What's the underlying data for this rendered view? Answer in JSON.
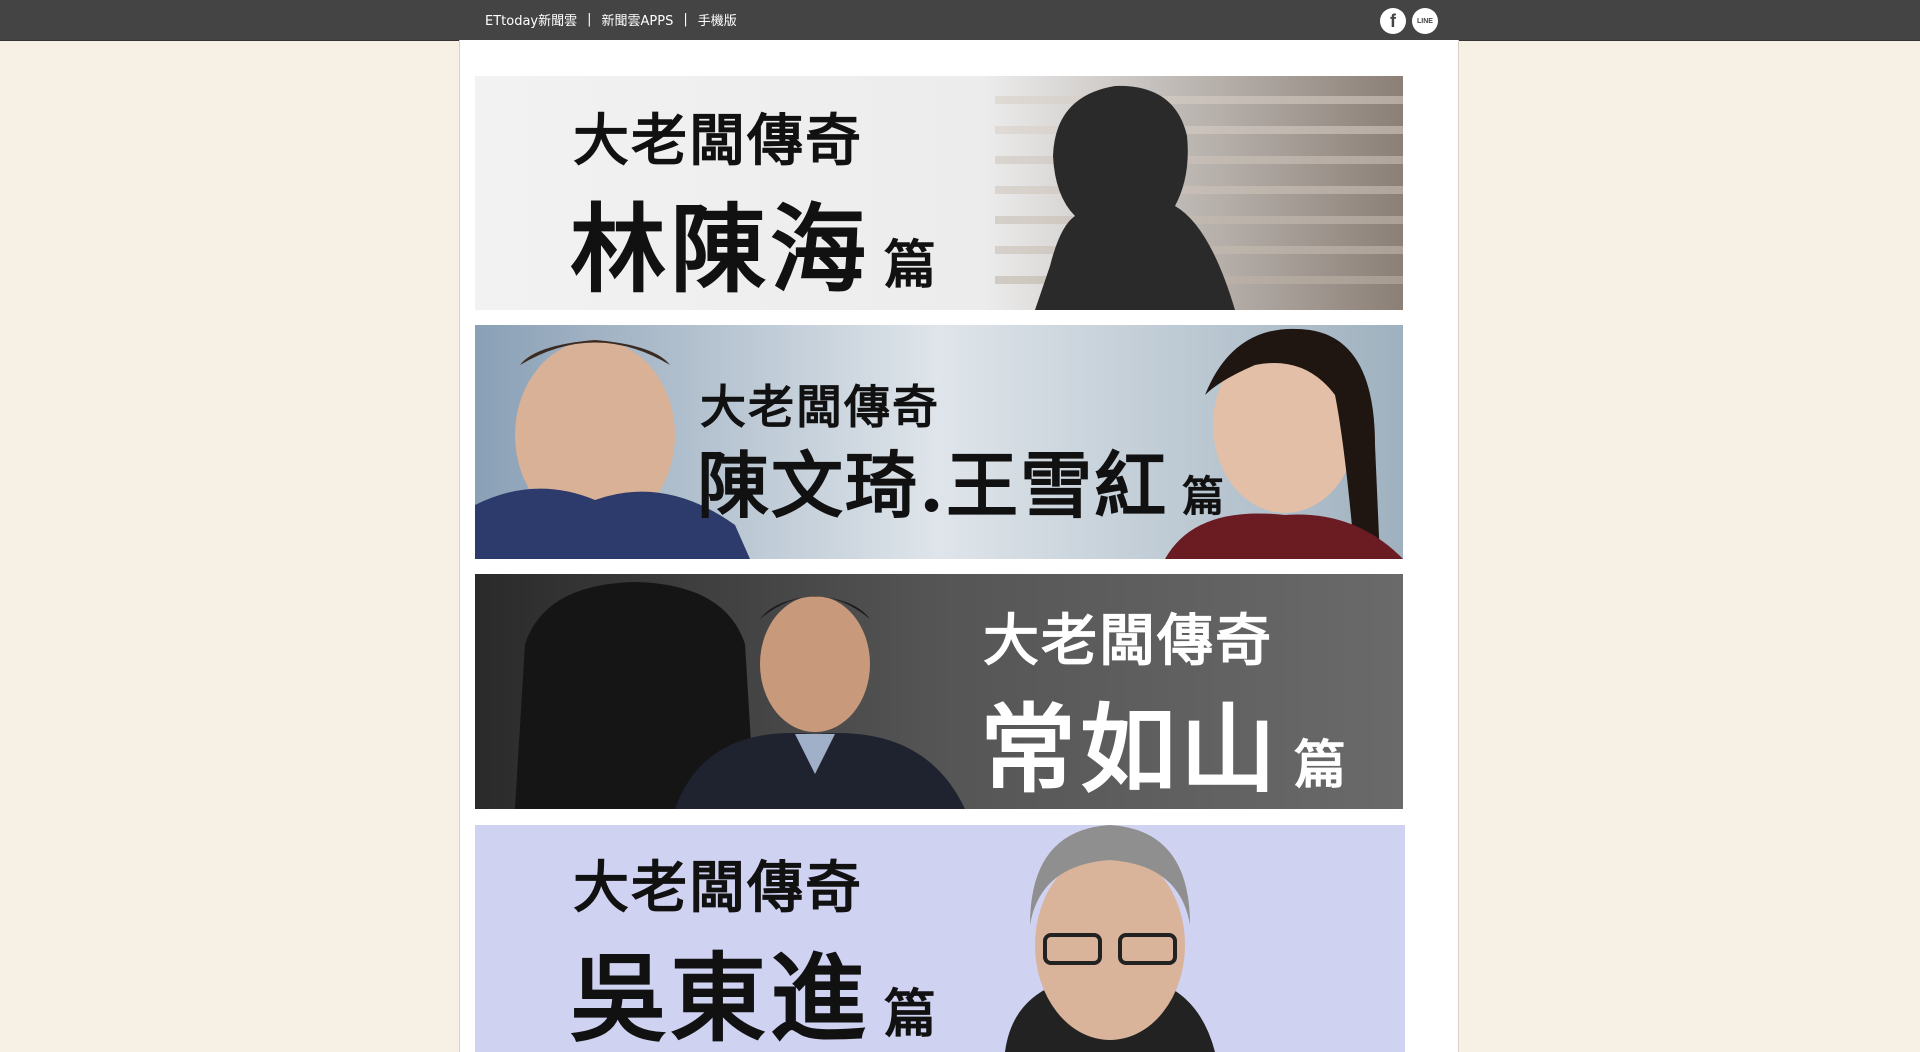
{
  "topbar": {
    "links": [
      "ETtoday新聞雲",
      "新聞雲APPS",
      "手機版"
    ],
    "separator": "|",
    "social": [
      {
        "icon": "facebook-icon",
        "label": "f"
      },
      {
        "icon": "line-icon",
        "label": "LINE"
      }
    ]
  },
  "banners": [
    {
      "series": "大老闆傳奇",
      "name": "林陳海",
      "suffix": "篇",
      "bg": "#f1f1f1",
      "text_color": "#111111"
    },
    {
      "series": "大老闆傳奇",
      "name": "陳文琦.王雪紅",
      "suffix": "篇",
      "bg": "#c9d3dc",
      "text_color": "#111111"
    },
    {
      "series": "大老闆傳奇",
      "name": "常如山",
      "suffix": "篇",
      "bg": "#4a4a4a",
      "text_color": "#ffffff"
    },
    {
      "series": "大老闆傳奇",
      "name": "吳東進",
      "suffix": "篇",
      "bg": "#cfd2f1",
      "text_color": "#111111"
    }
  ]
}
